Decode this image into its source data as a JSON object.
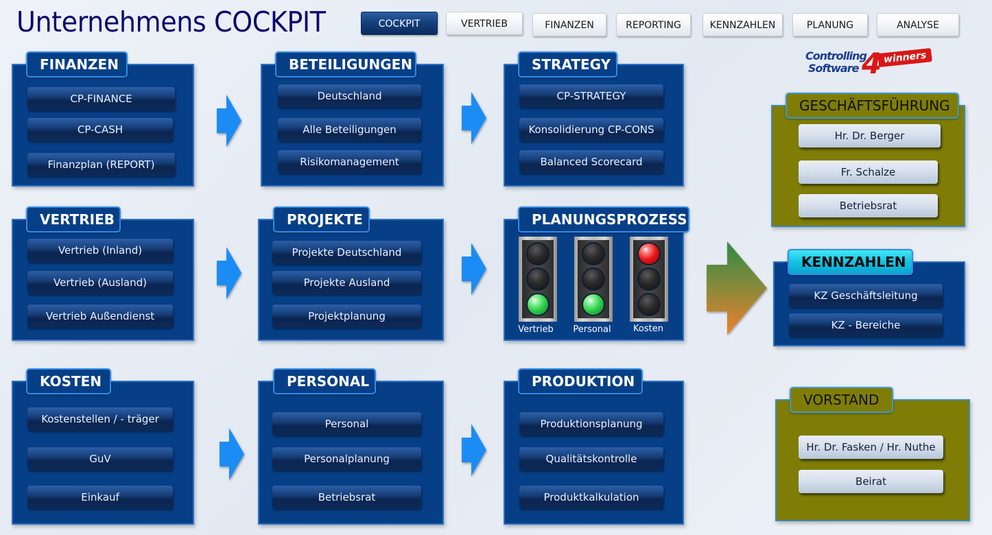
{
  "header": {
    "title": "Unternehmens COCKPIT"
  },
  "nav": {
    "items": [
      {
        "label": "COCKPIT",
        "active": true
      },
      {
        "label": "VERTRIEB",
        "active": false
      },
      {
        "label": "FINANZEN",
        "active": false
      },
      {
        "label": "REPORTING",
        "active": false
      },
      {
        "label": "KENNZAHLEN",
        "active": false
      },
      {
        "label": "PLANUNG",
        "active": false
      },
      {
        "label": "ANALYSE",
        "active": false
      }
    ]
  },
  "logo": {
    "line1": "Controlling",
    "line2": "Software",
    "four": "4",
    "badge": "winners"
  },
  "panels": {
    "finanzen": {
      "title": "FINANZEN",
      "buttons": [
        "CP-FINANCE",
        "CP-CASH",
        "Finanzplan (REPORT)"
      ]
    },
    "beteiligungen": {
      "title": "BETEILIGUNGEN",
      "buttons": [
        "Deutschland",
        "Alle Beteiligungen",
        "Risikomanagement"
      ]
    },
    "strategy": {
      "title": "STRATEGY",
      "buttons": [
        "CP-STRATEGY",
        "Konsolidierung CP-CONS",
        "Balanced Scorecard"
      ]
    },
    "vertrieb": {
      "title": "VERTRIEB",
      "buttons": [
        "Vertrieb (Inland)",
        "Vertrieb (Ausland)",
        "Vertrieb Außendienst"
      ]
    },
    "projekte": {
      "title": "PROJEKTE",
      "buttons": [
        "Projekte Deutschland",
        "Projekte Ausland",
        "Projektplanung"
      ]
    },
    "planungsprozess": {
      "title": "PLANUNGSPROZESS",
      "lights": [
        {
          "label": "Vertrieb",
          "state": "green"
        },
        {
          "label": "Personal",
          "state": "green"
        },
        {
          "label": "Kosten",
          "state": "red"
        }
      ]
    },
    "kosten": {
      "title": "KOSTEN",
      "buttons": [
        "Kostenstellen / - träger",
        "GuV",
        "Einkauf"
      ]
    },
    "personal": {
      "title": "PERSONAL",
      "buttons": [
        "Personal",
        "Personalplanung",
        "Betriebsrat"
      ]
    },
    "produktion": {
      "title": "PRODUKTION",
      "buttons": [
        "Produktionsplanung",
        "Qualitätskontrolle",
        "Produktkalkulation"
      ]
    },
    "geschaeftsfuehrung": {
      "title": "GESCHÄFTSFÜHRUNG",
      "buttons": [
        "Hr. Dr. Berger",
        "Fr. Schalze",
        "Betriebsrat"
      ]
    },
    "kennzahlen": {
      "title": "KENNZAHLEN",
      "buttons": [
        "KZ Geschäftsleitung",
        "KZ - Bereiche"
      ]
    },
    "vorstand": {
      "title": "VORSTAND",
      "buttons": [
        "Hr. Dr. Fasken / Hr. Nuthe",
        "Beirat"
      ]
    }
  },
  "colors": {
    "panel_blue": "#073f87",
    "olive": "#7f7d06",
    "arrow_blue": "#1e8cf5",
    "title_navy": "#0a0a6e",
    "light_green": "#2fd14e",
    "light_red": "#e81818"
  }
}
